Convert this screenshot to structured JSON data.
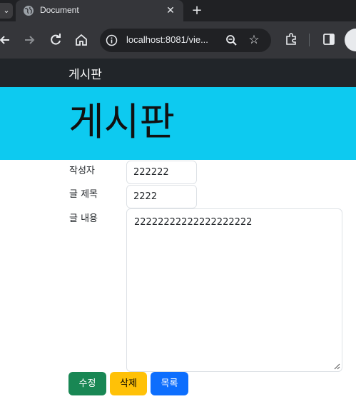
{
  "browser": {
    "tab": {
      "title": "Document",
      "favicon": "globe-icon",
      "close": "✕"
    },
    "new_tab": "+",
    "tab_search": "⌄",
    "address_bar": {
      "url": "localhost:8081/vie..."
    }
  },
  "page": {
    "navbar": {
      "brand": "게시판"
    },
    "jumbotron": {
      "title": "게시판"
    },
    "form": {
      "writer": {
        "label": "작성자",
        "value": "222222"
      },
      "title": {
        "label": "글 제목",
        "value": "2222"
      },
      "content": {
        "label": "글 내용",
        "value": "22222222222222222222"
      }
    },
    "buttons": {
      "edit": "수정",
      "delete": "삭제",
      "list": "목록"
    }
  },
  "colors": {
    "navbar_bg": "#212529",
    "jumbotron_bg": "#0dcaf0",
    "success": "#198754",
    "warning": "#ffc107",
    "primary": "#0d6efd"
  }
}
